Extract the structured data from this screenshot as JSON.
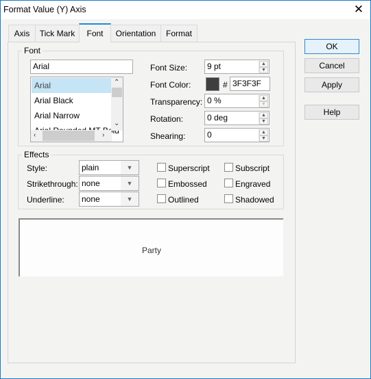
{
  "window": {
    "title": "Format Value (Y) Axis"
  },
  "tabs": [
    {
      "label": "Axis",
      "active": false
    },
    {
      "label": "Tick Mark",
      "active": false
    },
    {
      "label": "Font",
      "active": true
    },
    {
      "label": "Orientation",
      "active": false
    },
    {
      "label": "Format",
      "active": false
    }
  ],
  "font_group": {
    "legend": "Font",
    "font_name_value": "Arial",
    "font_list": [
      "Arial",
      "Arial Black",
      "Arial Narrow",
      "Arial Rounded MT Bold"
    ],
    "selected_font": "Arial",
    "font_size_label": "Font Size:",
    "font_size_value": "9 pt",
    "font_color_label": "Font Color:",
    "font_color_hash": "#",
    "font_color_value": "3F3F3F",
    "font_color_swatch": "#3f3f3f",
    "transparency_label": "Transparency:",
    "transparency_value": "0 %",
    "rotation_label": "Rotation:",
    "rotation_value": "0 deg",
    "shearing_label": "Shearing:",
    "shearing_value": "0"
  },
  "effects_group": {
    "legend": "Effects",
    "style_label": "Style:",
    "style_value": "plain",
    "strikethrough_label": "Strikethrough:",
    "strikethrough_value": "none",
    "underline_label": "Underline:",
    "underline_value": "none",
    "checkboxes": [
      {
        "label": "Superscript",
        "checked": false
      },
      {
        "label": "Subscript",
        "checked": false
      },
      {
        "label": "Embossed",
        "checked": false
      },
      {
        "label": "Engraved",
        "checked": false
      },
      {
        "label": "Outlined",
        "checked": false
      },
      {
        "label": "Shadowed",
        "checked": false
      }
    ]
  },
  "preview": {
    "text": "Party"
  },
  "buttons": {
    "ok": "OK",
    "cancel": "Cancel",
    "apply": "Apply",
    "help": "Help"
  }
}
